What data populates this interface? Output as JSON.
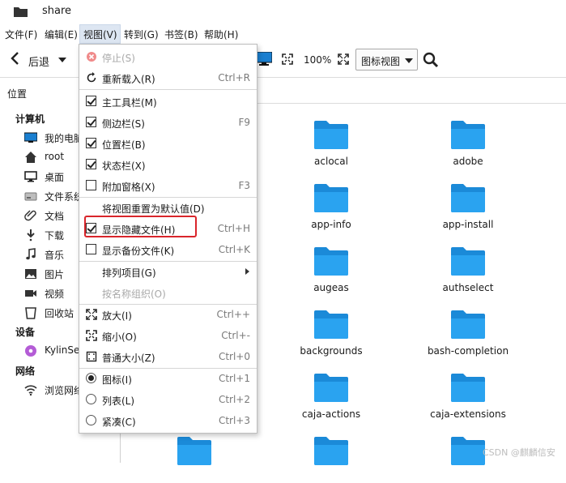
{
  "window": {
    "title": "share"
  },
  "menubar": {
    "items": [
      "文件(F)",
      "编辑(E)",
      "视图(V)",
      "转到(G)",
      "书签(B)",
      "帮助(H)"
    ],
    "active_index": 2
  },
  "toolbar": {
    "back_label": "后退",
    "zoom_level": "100%",
    "view_mode": "图标视图"
  },
  "sidebar": {
    "header": "位置",
    "sections": [
      {
        "title": "计算机",
        "items": [
          {
            "label": "我的电脑",
            "icon": "computer-icon"
          },
          {
            "label": "root",
            "icon": "home-icon"
          },
          {
            "label": "桌面",
            "icon": "desktop-icon"
          },
          {
            "label": "文件系统",
            "icon": "drive-icon"
          },
          {
            "label": "文档",
            "icon": "document-clip-icon"
          },
          {
            "label": "下载",
            "icon": "download-icon"
          },
          {
            "label": "音乐",
            "icon": "music-icon"
          },
          {
            "label": "图片",
            "icon": "picture-icon"
          },
          {
            "label": "视频",
            "icon": "video-icon"
          },
          {
            "label": "回收站",
            "icon": "trash-icon"
          }
        ]
      },
      {
        "title": "设备",
        "items": [
          {
            "label": "KylinSec",
            "icon": "disc-icon"
          }
        ]
      },
      {
        "title": "网络",
        "items": [
          {
            "label": "浏览网络",
            "icon": "wifi-icon"
          }
        ]
      }
    ]
  },
  "files": [
    "aclocal",
    "adobe",
    "app-info",
    "app-install",
    "augeas",
    "authselect",
    "backgrounds",
    "bash-completion",
    "caja-actions",
    "caja-extensions",
    "",
    ""
  ],
  "view_menu": {
    "items": [
      {
        "label": "停止(S)",
        "shortcut": "",
        "control": "icon",
        "checked": false,
        "disabled": true
      },
      {
        "label": "重新载入(R)",
        "shortcut": "Ctrl+R",
        "control": "icon",
        "checked": false,
        "disabled": false
      },
      {
        "label": "主工具栏(M)",
        "shortcut": "",
        "control": "check",
        "checked": true,
        "disabled": false
      },
      {
        "label": "侧边栏(S)",
        "shortcut": "F9",
        "control": "check",
        "checked": true,
        "disabled": false
      },
      {
        "label": "位置栏(B)",
        "shortcut": "",
        "control": "check",
        "checked": true,
        "disabled": false
      },
      {
        "label": "状态栏(X)",
        "shortcut": "",
        "control": "check",
        "checked": true,
        "disabled": false
      },
      {
        "label": "附加窗格(X)",
        "shortcut": "F3",
        "control": "check",
        "checked": false,
        "disabled": false
      },
      {
        "label": "将视图重置为默认值(D)",
        "shortcut": "",
        "control": "none",
        "checked": false,
        "disabled": false
      },
      {
        "label": "显示隐藏文件(H)",
        "shortcut": "Ctrl+H",
        "control": "check",
        "checked": true,
        "disabled": false
      },
      {
        "label": "显示备份文件(K)",
        "shortcut": "Ctrl+K",
        "control": "check",
        "checked": false,
        "disabled": false
      },
      {
        "label": "排列项目(G)",
        "shortcut": "",
        "control": "none",
        "checked": false,
        "disabled": false,
        "submenu": true
      },
      {
        "label": "按名称组织(O)",
        "shortcut": "",
        "control": "none",
        "checked": false,
        "disabled": true
      },
      {
        "label": "放大(I)",
        "shortcut": "Ctrl++",
        "control": "icon",
        "checked": false,
        "disabled": false
      },
      {
        "label": "缩小(O)",
        "shortcut": "Ctrl+-",
        "control": "icon",
        "checked": false,
        "disabled": false
      },
      {
        "label": "普通大小(Z)",
        "shortcut": "Ctrl+0",
        "control": "icon",
        "checked": false,
        "disabled": false
      },
      {
        "label": "图标(I)",
        "shortcut": "Ctrl+1",
        "control": "radio",
        "checked": true,
        "disabled": false
      },
      {
        "label": "列表(L)",
        "shortcut": "Ctrl+2",
        "control": "radio",
        "checked": false,
        "disabled": false
      },
      {
        "label": "紧凑(C)",
        "shortcut": "Ctrl+3",
        "control": "radio",
        "checked": false,
        "disabled": false
      }
    ]
  },
  "colors": {
    "folder": "#2aa3f0",
    "folder_dark": "#1b8ad8",
    "highlight": "#d9252b",
    "accent": "#1a7fd0"
  },
  "watermark": "CSDN @麒麟信安"
}
